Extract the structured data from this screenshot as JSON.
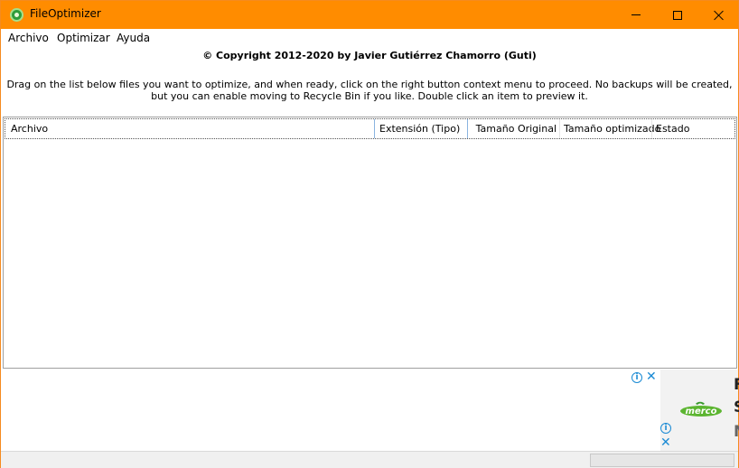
{
  "window": {
    "title": "FileOptimizer",
    "accent_color": "#ff8c00"
  },
  "menu": {
    "items": [
      "Archivo",
      "Optimizar",
      "Ayuda"
    ]
  },
  "header": {
    "copyright": "© Copyright 2012-2020 by Javier Gutiérrez Chamorro (Guti)",
    "instructions": "Drag on the list below files you want to optimize, and when ready, click on the right button context menu to proceed. No backups will be created, but you can enable moving to Recycle Bin if you like. Double click an item to preview it."
  },
  "list": {
    "columns": [
      "Archivo",
      "Extensión (Tipo)",
      "Tamaño Original",
      "Tamaño optimizado",
      "Estado"
    ],
    "rows": []
  },
  "ad": {
    "logo_text": "merco",
    "partial_letters": [
      "F",
      "S",
      "N"
    ],
    "icons": [
      "info-icon",
      "close-icon"
    ]
  }
}
